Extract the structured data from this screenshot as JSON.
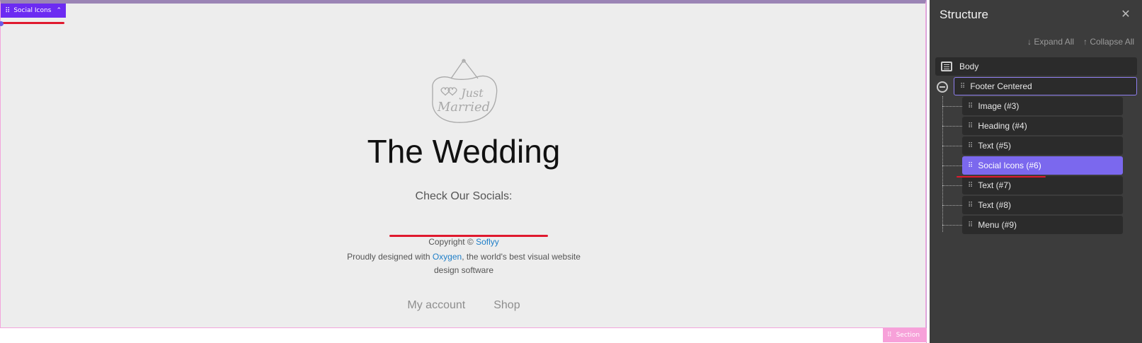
{
  "canvas": {
    "element_badge": {
      "label": "Social Icons",
      "caret": "⌃"
    },
    "footer": {
      "logo_line1": "Just",
      "logo_line2": "Married",
      "heading": "The Wedding",
      "socials_text": "Check Our Socials:",
      "copyright_prefix": "Copyright © ",
      "copyright_link": "Soflyy",
      "designed_prefix": "Proudly designed with ",
      "designed_link": "Oxygen",
      "designed_suffix": ", the world's best visual website design software",
      "menu": [
        "My account",
        "Shop"
      ]
    },
    "section_badge": "Section"
  },
  "panel": {
    "title": "Structure",
    "close": "✕",
    "expand_all": "↓ Expand All",
    "collapse_all": "↑ Collapse All",
    "body": "Body",
    "footer": "Footer Centered",
    "children": [
      "Image (#3)",
      "Heading (#4)",
      "Text (#5)",
      "Social Icons (#6)",
      "Text (#7)",
      "Text (#8)",
      "Menu (#9)"
    ],
    "selected_index": 3
  },
  "colors": {
    "accent_purple": "#7b68ee",
    "badge_purple": "#6c2bf2",
    "annotation_red": "#e0192e",
    "link_blue": "#1e7ec8"
  }
}
